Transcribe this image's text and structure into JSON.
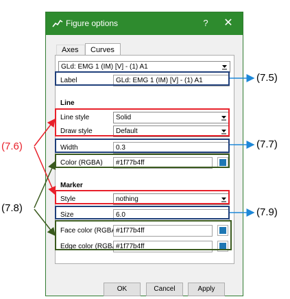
{
  "window": {
    "title": "Figure options",
    "help_glyph": "?",
    "close_glyph": "✕"
  },
  "tabs": [
    {
      "label": "Axes",
      "active": false
    },
    {
      "label": "Curves",
      "active": true
    }
  ],
  "curve_selector": {
    "value": "GLd: EMG 1 (IM) [V] - (1) A1"
  },
  "label_row": {
    "label": "Label",
    "value": "GLd: EMG 1 (IM) [V] - (1) A1"
  },
  "line": {
    "heading": "Line",
    "style_label": "Line style",
    "style_value": "Solid",
    "draw_label": "Draw style",
    "draw_value": "Default",
    "width_label": "Width",
    "width_value": "0.3",
    "color_label": "Color (RGBA)",
    "color_value": "#1f77b4ff"
  },
  "marker": {
    "heading": "Marker",
    "style_label": "Style",
    "style_value": "nothing",
    "size_label": "Size",
    "size_value": "6.0",
    "face_label": "Face color (RGBA)",
    "face_value": "#1f77b4ff",
    "edge_label": "Edge color (RGBA)",
    "edge_value": "#1f77b4ff"
  },
  "buttons": {
    "ok": "OK",
    "cancel": "Cancel",
    "apply": "Apply"
  },
  "annotations": {
    "a75": "(7.5)",
    "a76": "(7.6)",
    "a77": "(7.7)",
    "a78": "(7.8)",
    "a79": "(7.9)"
  },
  "colors": {
    "titlebar": "#2e8b2e",
    "swatch": "#1f77b4",
    "highlight_red": "#e8202a",
    "highlight_blue": "#1f3f7a",
    "highlight_green": "#3a5a1e",
    "arrow_blue": "#1e88d8"
  }
}
